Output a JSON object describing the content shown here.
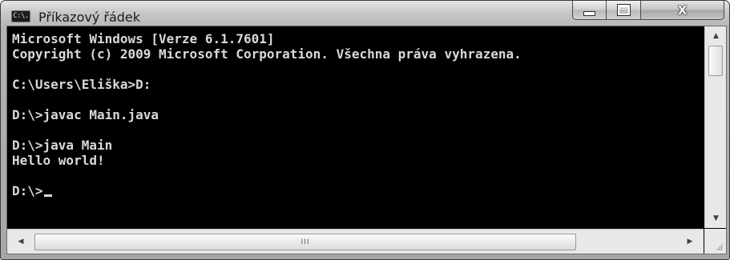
{
  "window": {
    "title": "Příkazový řádek",
    "icon": {
      "name": "cmd-icon",
      "label": "C:\\."
    },
    "buttons": {
      "minimize": "minimize-icon",
      "maximize": "maximize-icon",
      "close": "close-icon",
      "close_label": "X"
    }
  },
  "console": {
    "lines": [
      "Microsoft Windows [Verze 6.1.7601]",
      "Copyright (c) 2009 Microsoft Corporation. Všechna práva vyhrazena.",
      "",
      "C:\\Users\\Eliška>D:",
      "",
      "D:\\>javac Main.java",
      "",
      "D:\\>java Main",
      "Hello world!",
      "",
      "D:\\>"
    ]
  },
  "scrollbars": {
    "horizontal_grip": "III"
  },
  "colors": {
    "console_background": "#000000",
    "console_text": "#d9d9d9",
    "chrome": "#b4b4b4"
  }
}
